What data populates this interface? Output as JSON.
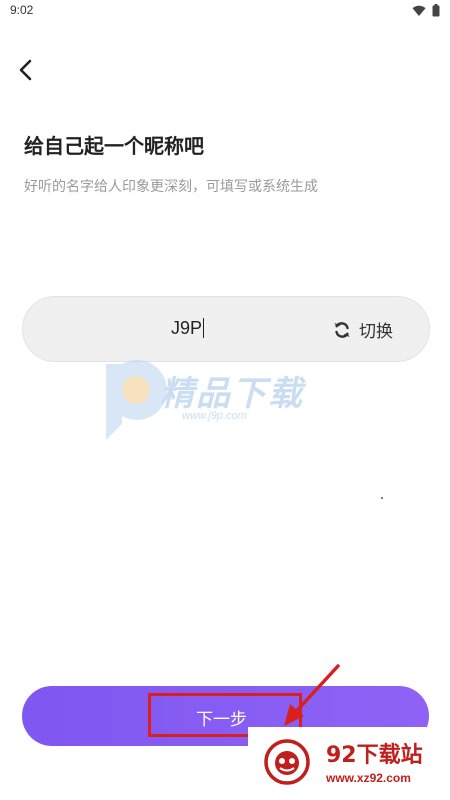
{
  "status_bar": {
    "time": "9:02"
  },
  "header": {
    "back_icon": "chevron-left-icon"
  },
  "main": {
    "title": "给自己起一个昵称吧",
    "subtitle": "好听的名字给人印象更深刻，可填写或系统生成",
    "nickname": {
      "value": "J9P"
    },
    "switch_label": "切换",
    "next_label": "下一步"
  },
  "watermark": {
    "text": "精品下载",
    "url": "www.j9p.com"
  },
  "site_badge": {
    "name": "92下载站",
    "url": "www.xz92.com"
  },
  "colors": {
    "accent": "#8a5cf5",
    "annotation": "#d92020",
    "brand": "#c0201d"
  }
}
